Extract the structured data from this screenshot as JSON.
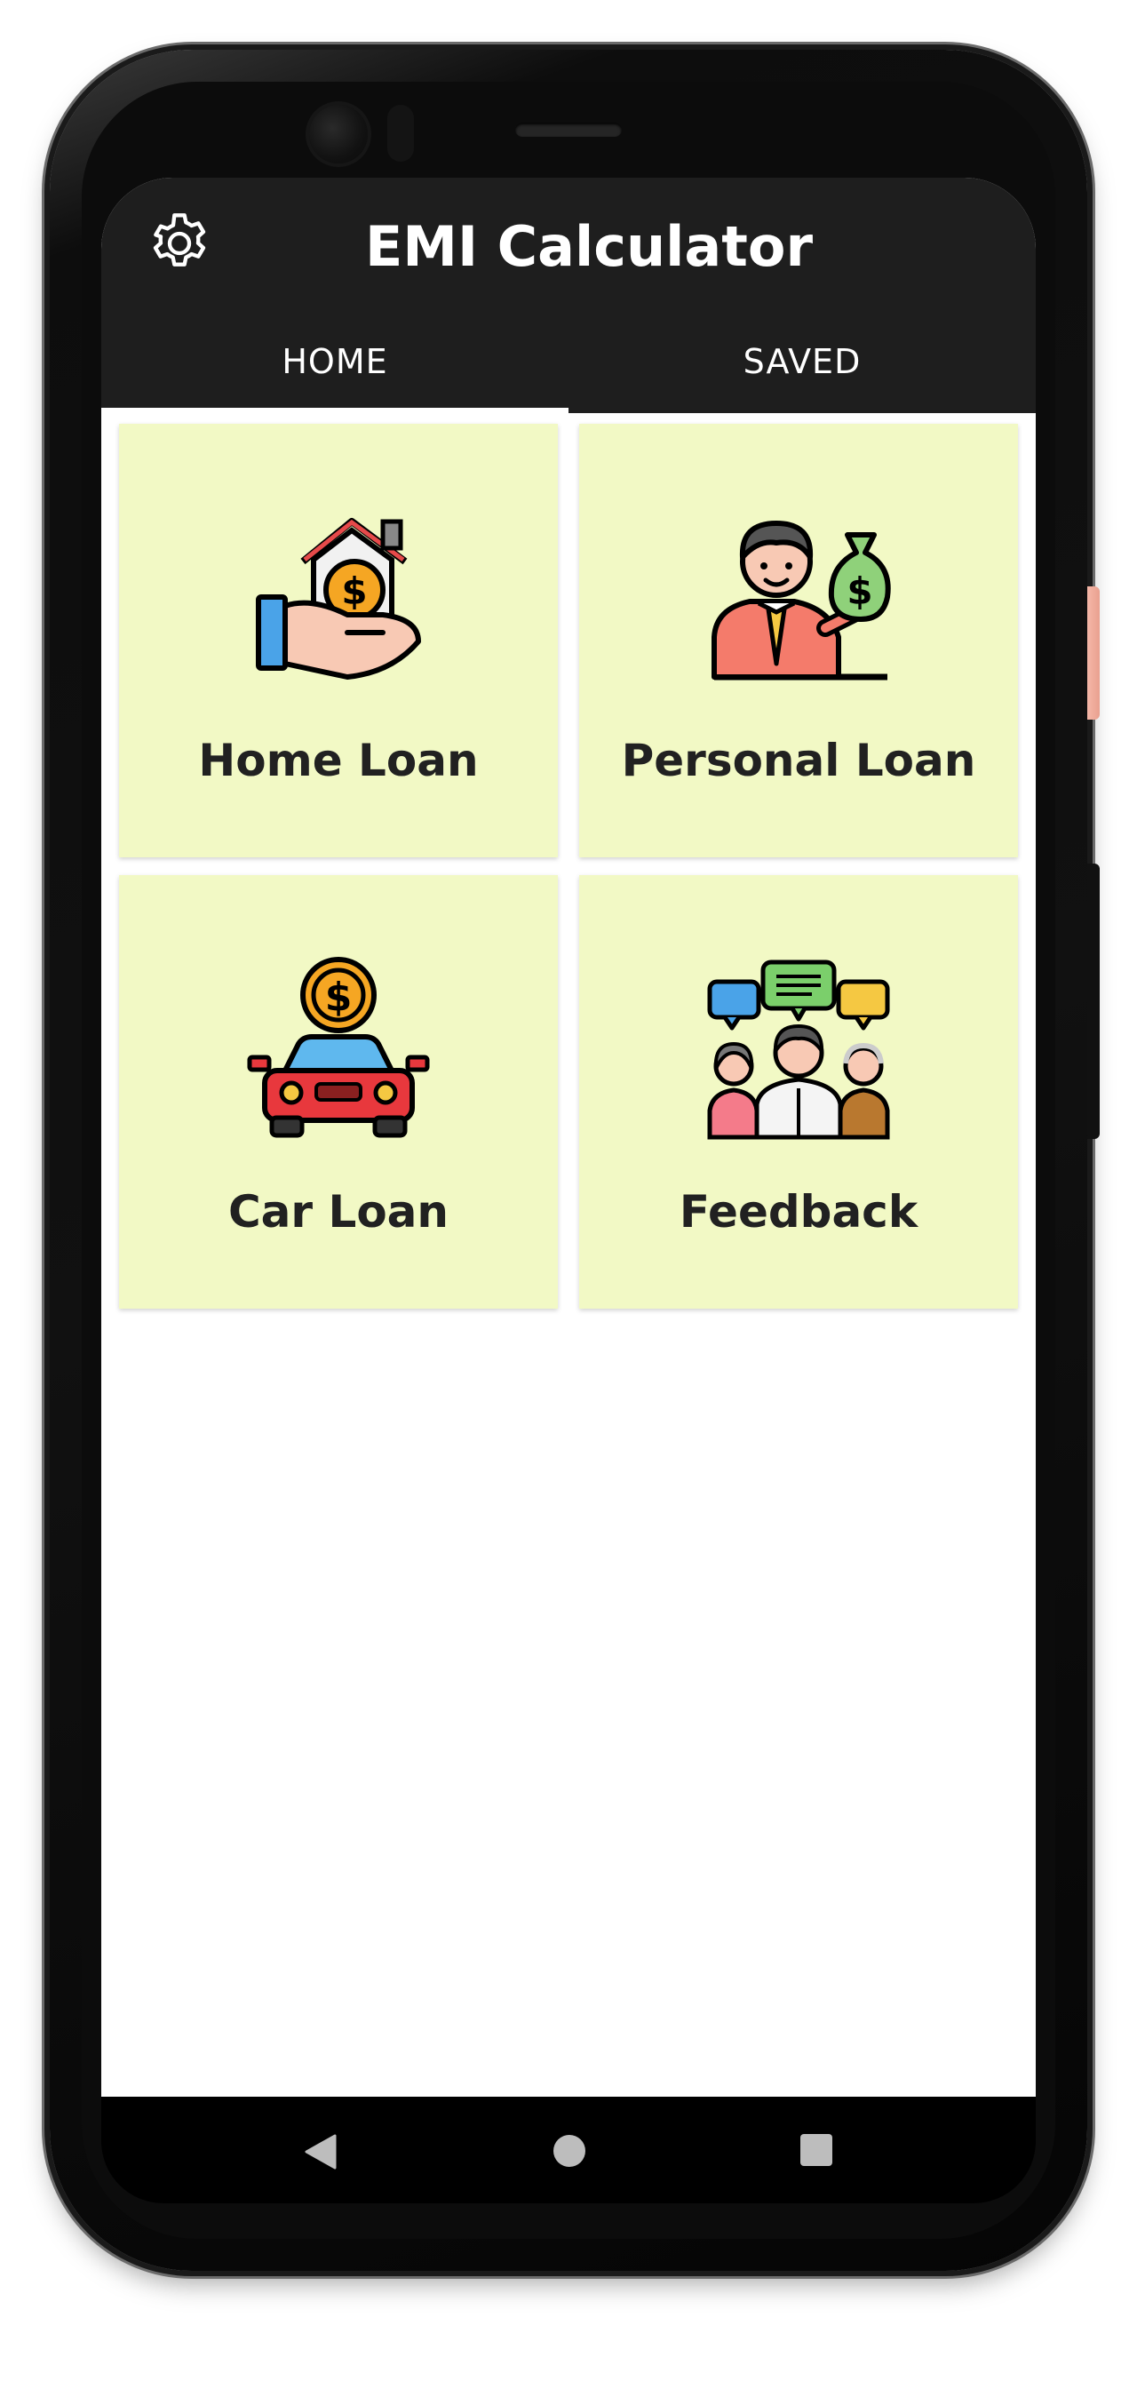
{
  "app": {
    "title": "EMI Calculator"
  },
  "tabs": [
    {
      "label": "HOME",
      "active": true
    },
    {
      "label": "SAVED",
      "active": false
    }
  ],
  "cards": [
    {
      "label": "Home Loan",
      "icon": "home-loan-icon"
    },
    {
      "label": "Personal Loan",
      "icon": "personal-loan-icon"
    },
    {
      "label": "Car Loan",
      "icon": "car-loan-icon"
    },
    {
      "label": "Feedback",
      "icon": "feedback-icon"
    }
  ],
  "colors": {
    "app_bar": "#1e1e1e",
    "card_background": "#f2f9c5",
    "label_text": "#212121",
    "nav_bar": "#000000"
  },
  "icons": {
    "settings": "gear-icon",
    "nav_back": "back-triangle-icon",
    "nav_home": "home-circle-icon",
    "nav_recent": "recents-square-icon"
  }
}
